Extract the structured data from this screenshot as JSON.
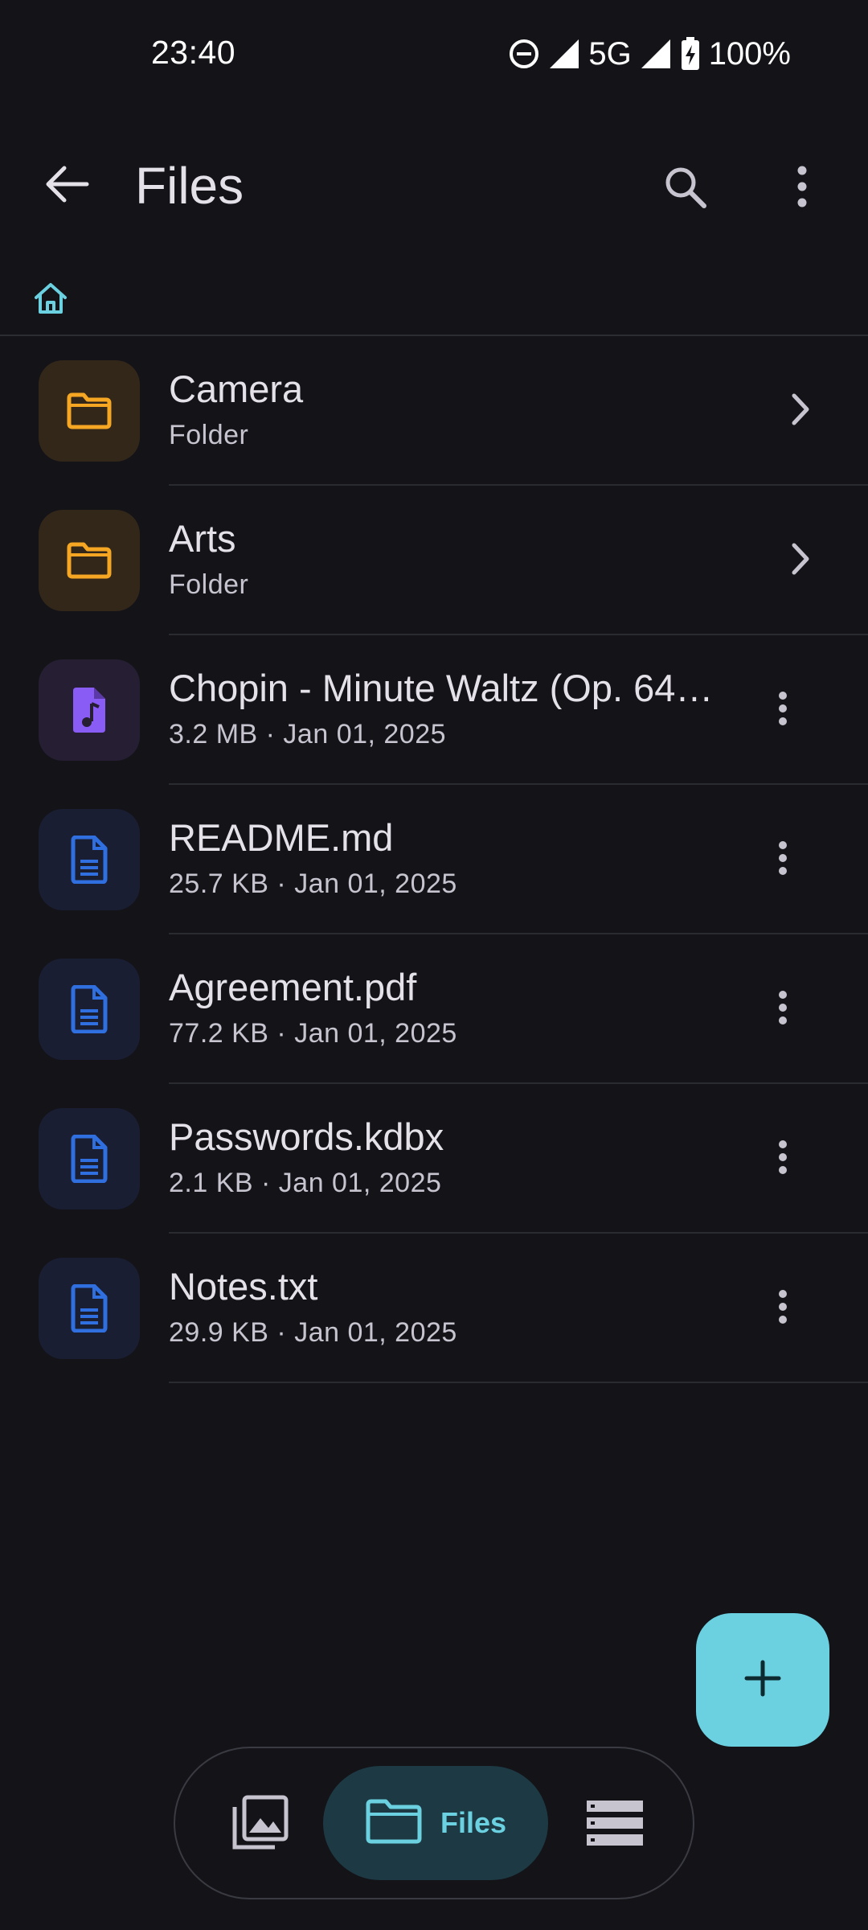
{
  "status_bar": {
    "time": "23:40",
    "network": "5G",
    "battery": "100%",
    "icons": [
      "dnd-icon",
      "signal-icon",
      "signal-icon",
      "battery-charging-icon"
    ]
  },
  "app_bar": {
    "title": "Files",
    "back_icon": "arrow-back-icon",
    "search_icon": "search-icon",
    "menu_icon": "more-vert-icon"
  },
  "breadcrumb": {
    "home_icon": "home-icon"
  },
  "files": [
    {
      "name": "Camera",
      "meta": "Folder",
      "kind": "folder",
      "icon": "folder-icon",
      "action_icon": "chevron-right-icon"
    },
    {
      "name": "Arts",
      "meta": "Folder",
      "kind": "folder",
      "icon": "folder-icon",
      "action_icon": "chevron-right-icon"
    },
    {
      "name": "Chopin - Minute Waltz (Op. 64…",
      "meta": "3.2 MB · Jan 01, 2025",
      "kind": "audio",
      "icon": "audio-file-icon",
      "action_icon": "more-vert-icon"
    },
    {
      "name": "README.md",
      "meta": "25.7 KB · Jan 01, 2025",
      "kind": "doc",
      "icon": "document-icon",
      "action_icon": "more-vert-icon"
    },
    {
      "name": "Agreement.pdf",
      "meta": "77.2 KB · Jan 01, 2025",
      "kind": "doc",
      "icon": "document-icon",
      "action_icon": "more-vert-icon"
    },
    {
      "name": "Passwords.kdbx",
      "meta": "2.1 KB · Jan 01, 2025",
      "kind": "doc",
      "icon": "document-icon",
      "action_icon": "more-vert-icon"
    },
    {
      "name": "Notes.txt",
      "meta": "29.9 KB · Jan 01, 2025",
      "kind": "doc",
      "icon": "document-icon",
      "action_icon": "more-vert-icon"
    }
  ],
  "fab": {
    "icon": "add-icon"
  },
  "bottom_nav": {
    "gallery_icon": "photo-library-icon",
    "files_label": "Files",
    "files_icon": "folder-icon",
    "storage_icon": "storage-icon"
  },
  "colors": {
    "background": "#131318",
    "accent": "#6bd0e0",
    "folder": "#f5a623",
    "audio": "#8a5cf6",
    "document": "#2f6fe0"
  }
}
